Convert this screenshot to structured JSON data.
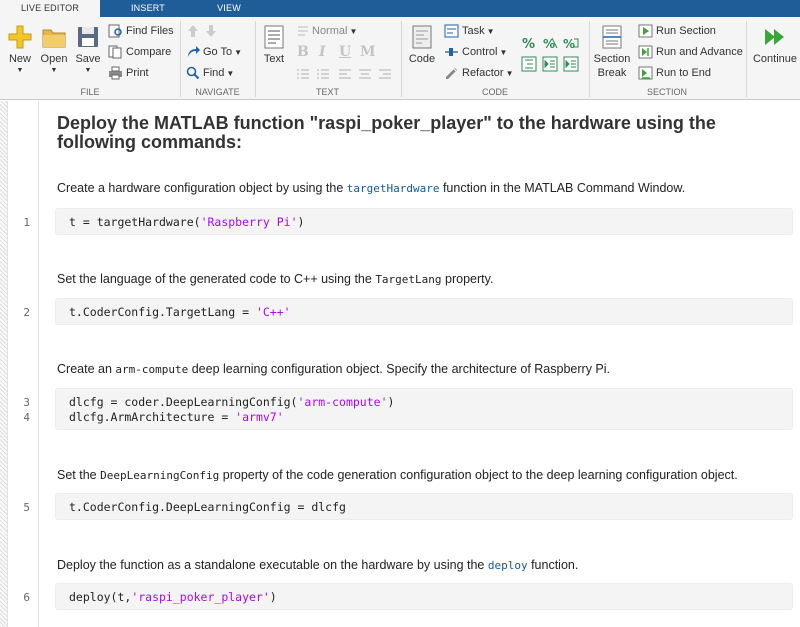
{
  "tabs": [
    {
      "label": "LIVE EDITOR",
      "active": true
    },
    {
      "label": "INSERT",
      "active": false
    },
    {
      "label": "VIEW",
      "active": false
    }
  ],
  "ribbon": {
    "file": {
      "group": "FILE",
      "new": "New",
      "open": "Open",
      "save": "Save",
      "find_files": "Find Files",
      "compare": "Compare",
      "print": "Print"
    },
    "navigate": {
      "group": "NAVIGATE",
      "goto": "Go To",
      "find": "Find"
    },
    "text": {
      "group": "TEXT",
      "text_btn": "Text",
      "style": "Normal",
      "bold": "B",
      "italic": "I",
      "underline": "U",
      "mono": "M"
    },
    "code": {
      "group": "CODE",
      "code_btn": "Code",
      "task": "Task",
      "control": "Control",
      "refactor": "Refactor"
    },
    "section": {
      "group": "SECTION",
      "section_break_1": "Section",
      "section_break_2": "Break",
      "run_section": "Run Section",
      "run_advance": "Run and Advance",
      "run_end": "Run to End"
    },
    "run": {
      "continue": "Continue"
    }
  },
  "document": {
    "title": "Deploy the MATLAB function \"raspi_poker_player\" to the hardware using the following commands:",
    "steps": [
      {
        "pre": "Create a hardware configuration object by using the ",
        "code": "targetHardware",
        "post": " function in the MATLAB Command Window.",
        "lines": [
          {
            "num": "1",
            "code": "t = targetHardware(",
            "str": "'Raspberry Pi'",
            "tail": ")"
          }
        ]
      },
      {
        "pre": "Set the language of the generated code to C++ using the ",
        "code": "TargetLang",
        "post": "  property.",
        "lines": [
          {
            "num": "2",
            "code": "t.CoderConfig.TargetLang = ",
            "str": "'C++'",
            "tail": ""
          }
        ]
      },
      {
        "pre": "Create an ",
        "code": "arm-compute",
        "post": "  deep learning configuration object. Specify the architecture of Raspberry Pi.",
        "lines": [
          {
            "num": "3",
            "code": "dlcfg = coder.DeepLearningConfig(",
            "str": "'arm-compute'",
            "tail": ")"
          },
          {
            "num": "4",
            "code": "dlcfg.ArmArchitecture = ",
            "str": "'armv7'",
            "tail": ""
          }
        ]
      },
      {
        "pre": "Set the ",
        "code": "DeepLearningConfig",
        "post": " property of the code generation configuration object to the deep learning configuration object.",
        "lines": [
          {
            "num": "5",
            "code": "t.CoderConfig.DeepLearningConfig = dlcfg",
            "str": "",
            "tail": ""
          }
        ]
      },
      {
        "pre": "Deploy the function as a standalone executable on the hardware by using the ",
        "code": "deploy",
        "post": " function.",
        "lines": [
          {
            "num": "6",
            "code": "deploy(t,",
            "str": "'raspi_poker_player'",
            "tail": ")"
          }
        ]
      }
    ]
  },
  "colors": {
    "tab_bar": "#1e5d97",
    "string": "#a709f5",
    "link_code": "#0e5a9e",
    "run_green": "#3aa53a"
  }
}
